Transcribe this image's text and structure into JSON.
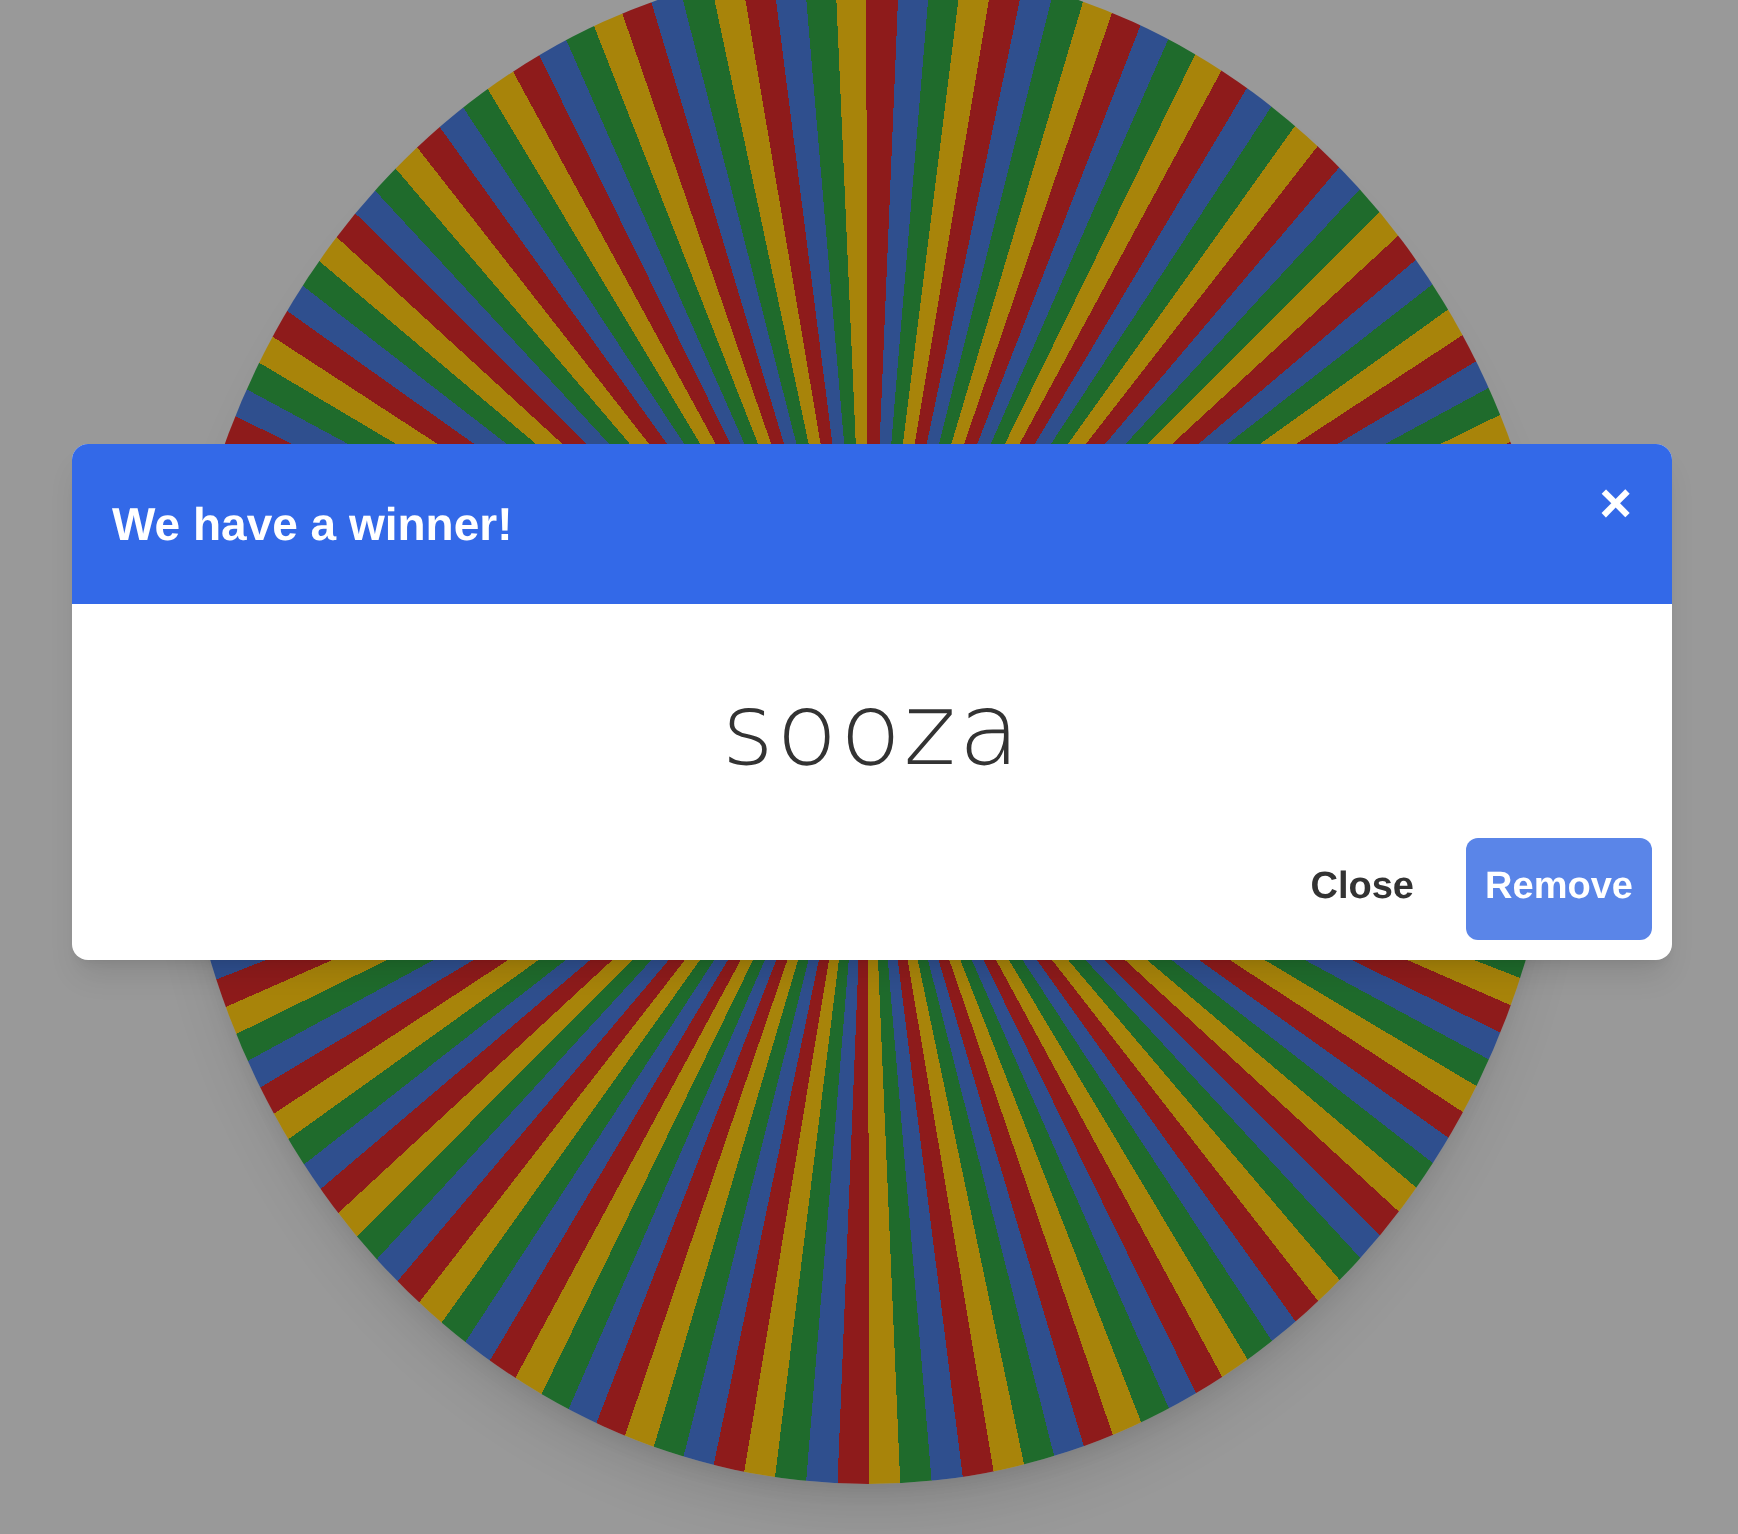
{
  "dialog": {
    "title": "We have a winner!",
    "close_icon": "×",
    "winner": "sooza",
    "buttons": [
      {
        "label": "Close",
        "kind": "text"
      },
      {
        "label": "Remove",
        "kind": "primary"
      }
    ]
  }
}
